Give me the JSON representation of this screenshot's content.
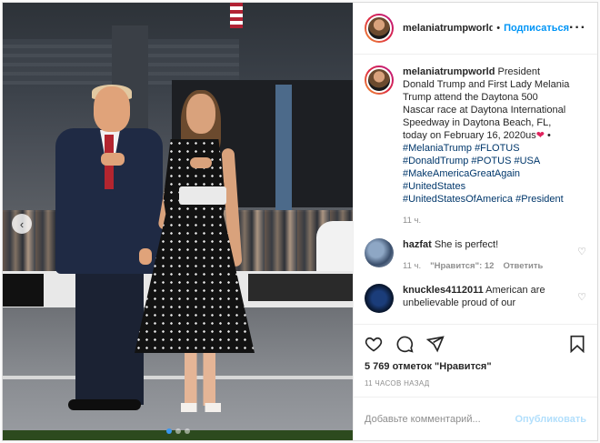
{
  "header": {
    "username": "melaniatrumpworld",
    "separator": "•",
    "follow_label": "Подписаться",
    "more_icon": "ellipsis-icon"
  },
  "caption": {
    "username": "melaniatrumpworld",
    "text": "President Donald Trump and First Lady Melania Trump attend the Daytona 500 Nascar race at Daytona International Speedway in Daytona Beach, FL, today on February 16, 2020us",
    "emoji": "❤",
    "bullet": "•",
    "hashtags": "#MelaniaTrump #FLOTUS #DonaldTrump #POTUS #USA #MakeAmericaGreatAgain #UnitedStates #UnitedStatesOfAmerica #President",
    "time": "11 ч."
  },
  "comments": [
    {
      "username": "hazfat",
      "text": "She is perfect!",
      "time": "11 ч.",
      "likes": "\"Нравится\": 12",
      "reply": "Ответить"
    },
    {
      "username": "knuckles4112011",
      "text": "American are unbelievable proud of our"
    }
  ],
  "photo": {
    "prev_icon": "chevron-left-icon",
    "slides_total": 3,
    "slide_active": 1
  },
  "actions": {
    "like_count": "5 769 отметок \"Нравится\"",
    "timestamp": "11 ЧАСОВ НАЗАД"
  },
  "add_comment": {
    "placeholder": "Добавьте комментарий...",
    "post_label": "Опубликовать"
  },
  "colors": {
    "link_blue": "#0095f6",
    "hashtag": "#00376b",
    "heart": "#e0245e"
  }
}
